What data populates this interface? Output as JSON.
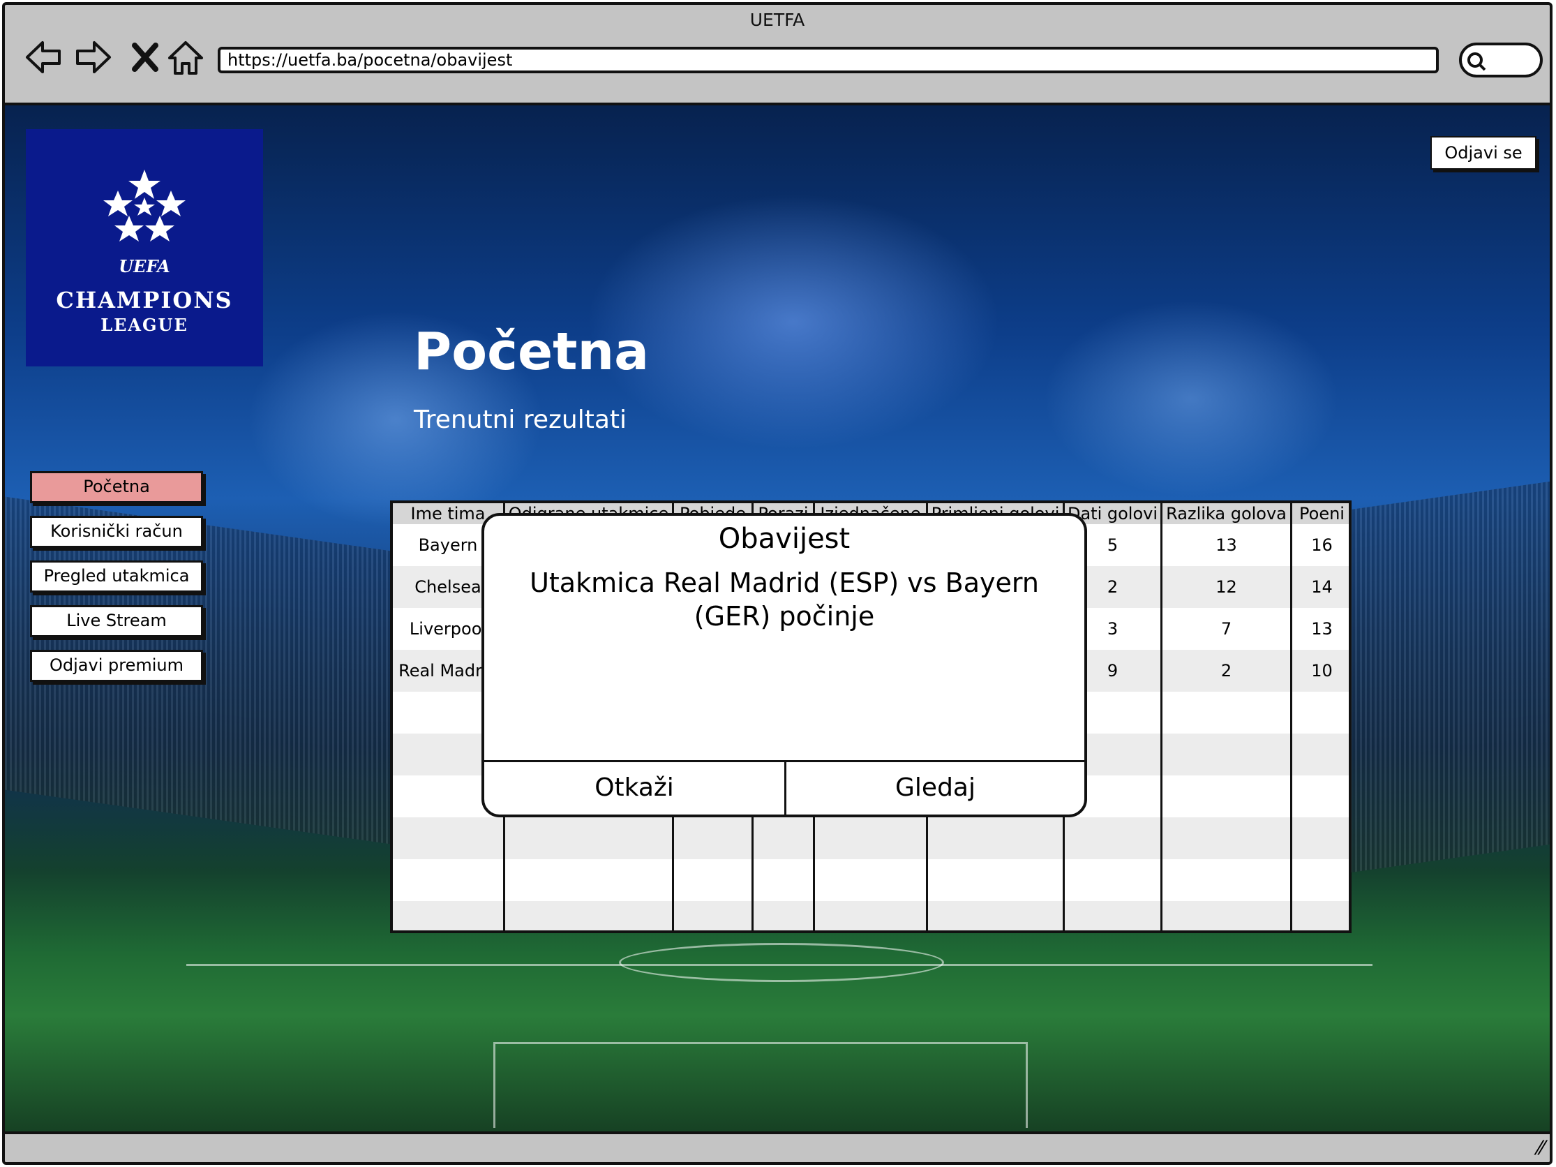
{
  "browser": {
    "title": "UETFA",
    "url": "https://uetfa.ba/pocetna/obavijest",
    "icons": [
      "back-icon",
      "forward-icon",
      "close-icon",
      "home-icon",
      "search-icon"
    ]
  },
  "logo": {
    "uetfa": "UEFA",
    "line1": "CHAMPIONS",
    "line2": "LEAGUE"
  },
  "header": {
    "logout_label": "Odjavi se"
  },
  "page": {
    "title": "Početna",
    "subtitle": "Trenutni rezultati"
  },
  "sidebar": {
    "items": [
      {
        "label": "Početna",
        "active": true
      },
      {
        "label": "Korisnički račun",
        "active": false
      },
      {
        "label": "Pregled utakmica",
        "active": false
      },
      {
        "label": "Live Stream",
        "active": false
      },
      {
        "label": "Odjavi premium",
        "active": false
      }
    ]
  },
  "table": {
    "columns": [
      "Ime tima",
      "Odigrane utakmice",
      "Pobjede",
      "Porazi",
      "Izjednačene",
      "Primljeni golovi",
      "Dati golovi",
      "Razlika golova",
      "Poeni"
    ],
    "rows": [
      {
        "team": "Bayern",
        "dati": "5",
        "razlika": "13",
        "poeni": "16"
      },
      {
        "team": "Chelsea",
        "dati": "2",
        "razlika": "12",
        "poeni": "14"
      },
      {
        "team": "Liverpool",
        "dati": "3",
        "razlika": "7",
        "poeni": "13"
      },
      {
        "team": "Real Madrid",
        "dati": "9",
        "razlika": "2",
        "poeni": "10"
      }
    ]
  },
  "modal": {
    "title": "Obavijest",
    "message": "Utakmica Real Madrid (ESP) vs Bayern (GER) počinje",
    "cancel_label": "Otkaži",
    "watch_label": "Gledaj"
  },
  "colors": {
    "active_nav": "#e99a9a",
    "logo_bg": "#0a1a8c"
  }
}
